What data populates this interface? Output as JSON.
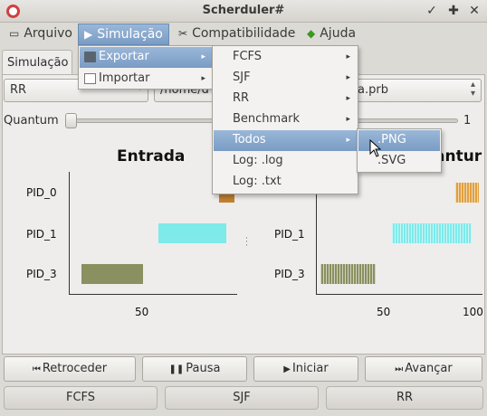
{
  "window": {
    "title": "Scherduler#",
    "minimize_glyph": "✓",
    "maximize_glyph": "✚",
    "close_glyph": "✕"
  },
  "menubar": {
    "arquivo": {
      "label": "Arquivo",
      "icon": "file-icon"
    },
    "simulacao": {
      "label": "Simulação",
      "icon": "play-icon"
    },
    "compat": {
      "label": "Compatibilidade",
      "icon": "tools-icon"
    },
    "ajuda": {
      "label": "Ajuda",
      "icon": "help-icon"
    }
  },
  "simulacao_menu": {
    "exportar": "Exportar",
    "importar": "Importar"
  },
  "exportar_menu": [
    "FCFS",
    "SJF",
    "RR",
    "Benchmark",
    "Todos",
    "Log: .log",
    "Log: .txt"
  ],
  "todos_menu": [
    ".PNG",
    ".SVG"
  ],
  "tab": {
    "label": "Simulação"
  },
  "controls": {
    "algorithm": "RR",
    "path_prefix": "/home/d",
    "path_suffix": "a.prb",
    "quantum_label": "Quantum",
    "quantum_value": "1"
  },
  "chart_data": [
    {
      "type": "bar",
      "title": "Entrada",
      "categories": [
        "PID_0",
        "PID_1",
        "PID_3"
      ],
      "x_ticks": [
        "50"
      ],
      "series": [
        {
          "category": "PID_0",
          "start": 90,
          "end": 100,
          "color": "#c08030"
        },
        {
          "category": "PID_1",
          "start": 50,
          "end": 95,
          "color": "#7eeaea"
        },
        {
          "category": "PID_3",
          "start": 0,
          "end": 40,
          "color": "#8a9060"
        }
      ]
    },
    {
      "type": "bar",
      "title": "Quantum",
      "title_visible": "antur",
      "categories": [
        "PID_0",
        "PID_1",
        "PID_3"
      ],
      "x_ticks": [
        "50",
        "100"
      ],
      "series": [
        {
          "category": "PID_0",
          "start": 85,
          "end": 100,
          "color": "#e0a040"
        },
        {
          "category": "PID_1",
          "start": 45,
          "end": 95,
          "color": "#7eeaea"
        },
        {
          "category": "PID_3",
          "start": 0,
          "end": 35,
          "color": "#8a9060"
        }
      ]
    }
  ],
  "buttons": {
    "retroceder": "Retroceder",
    "pausa": "Pausa",
    "iniciar": "Iniciar",
    "avancar": "Avançar"
  },
  "algo_tabs": [
    "FCFS",
    "SJF",
    "RR"
  ]
}
